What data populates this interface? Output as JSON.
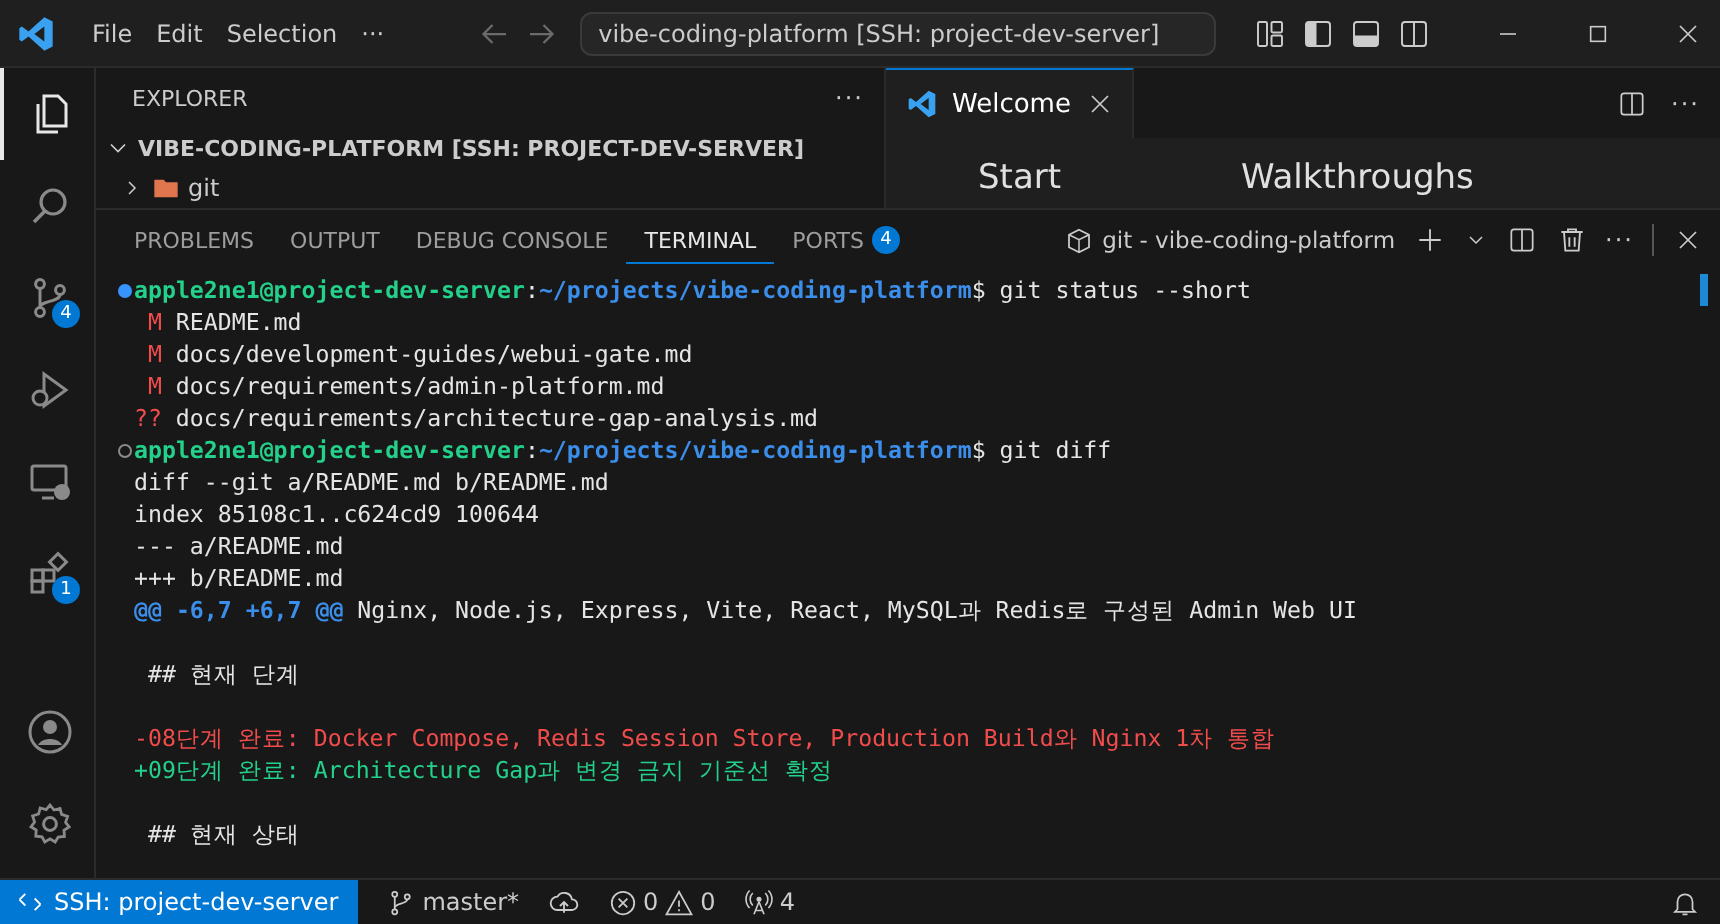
{
  "title_bar": {
    "menus": [
      "File",
      "Edit",
      "Selection"
    ],
    "more": "···",
    "command_center": "vibe-coding-platform [SSH: project-dev-server]"
  },
  "activity_bar": {
    "top": [
      {
        "kind": "explorer",
        "selected": true
      },
      {
        "kind": "search",
        "selected": false
      },
      {
        "kind": "source-control",
        "selected": false,
        "badge": "4"
      },
      {
        "kind": "run-debug",
        "selected": false
      },
      {
        "kind": "remote",
        "selected": false
      },
      {
        "kind": "extensions",
        "selected": false,
        "badge": "1"
      }
    ],
    "bottom": [
      {
        "kind": "account",
        "selected": false
      },
      {
        "kind": "settings",
        "selected": false
      }
    ]
  },
  "sidebar": {
    "title": "EXPLORER",
    "more": "···",
    "folder": "VIBE-CODING-PLATFORM [SSH: PROJECT-DEV-SERVER]",
    "expanded": true,
    "items": [
      {
        "label": "git",
        "expanded": false
      }
    ]
  },
  "editor": {
    "tabs": [
      {
        "label": "Welcome",
        "selected": true
      }
    ],
    "headings": [
      "Start",
      "Walkthroughs"
    ],
    "more": "···"
  },
  "panel": {
    "tabs": [
      {
        "label": "PROBLEMS",
        "selected": false
      },
      {
        "label": "OUTPUT",
        "selected": false
      },
      {
        "label": "DEBUG CONSOLE",
        "selected": false
      },
      {
        "label": "TERMINAL",
        "selected": true
      },
      {
        "label": "PORTS",
        "selected": false,
        "badge": "4"
      }
    ],
    "terminal_name": "git - vibe-coding-platform",
    "more": "···",
    "lines": [
      {
        "kind": "prompt",
        "success": true,
        "user": "apple2ne1@project-dev-server",
        "sep": ":",
        "path": "~/projects/vibe-coding-platform",
        "command": "$ git status --short"
      },
      {
        "kind": "status",
        "code": "M",
        "file": "README.md"
      },
      {
        "kind": "status",
        "code": "M",
        "file": "docs/development-guides/webui-gate.md"
      },
      {
        "kind": "status",
        "code": "M",
        "file": "docs/requirements/admin-platform.md"
      },
      {
        "kind": "status",
        "code": "??",
        "file": "docs/requirements/architecture-gap-analysis.md"
      },
      {
        "kind": "prompt",
        "success": false,
        "user": "apple2ne1@project-dev-server",
        "sep": ":",
        "path": "~/projects/vibe-coding-platform",
        "command": "$ git diff"
      },
      {
        "kind": "plain",
        "text": "diff --git a/README.md b/README.md"
      },
      {
        "kind": "plain",
        "text": "index 85108c1..c624cd9 100644"
      },
      {
        "kind": "plain",
        "text": "--- a/README.md"
      },
      {
        "kind": "plain",
        "text": "+++ b/README.md"
      },
      {
        "kind": "hunk",
        "range": "@@ -6,7 +6,7 @@",
        "text": " Nginx, Node.js, Express, Vite, React, MySQL과 Redis로 구성된 Admin Web UI"
      },
      {
        "kind": "blank"
      },
      {
        "kind": "context",
        "text": " ## 현재 단계"
      },
      {
        "kind": "blank"
      },
      {
        "kind": "removed",
        "text": "-08단계 완료: Docker Compose, Redis Session Store, Production Build와 Nginx 1차 통합"
      },
      {
        "kind": "added",
        "text": "+09단계 완료: Architecture Gap과 변경 금지 기준선 확정"
      },
      {
        "kind": "blank"
      },
      {
        "kind": "context",
        "text": " ## 현재 상태"
      }
    ]
  },
  "status_bar": {
    "remote": "SSH: project-dev-server",
    "branch": "master*",
    "errors": "0",
    "warnings": "0",
    "ports": "4"
  }
}
